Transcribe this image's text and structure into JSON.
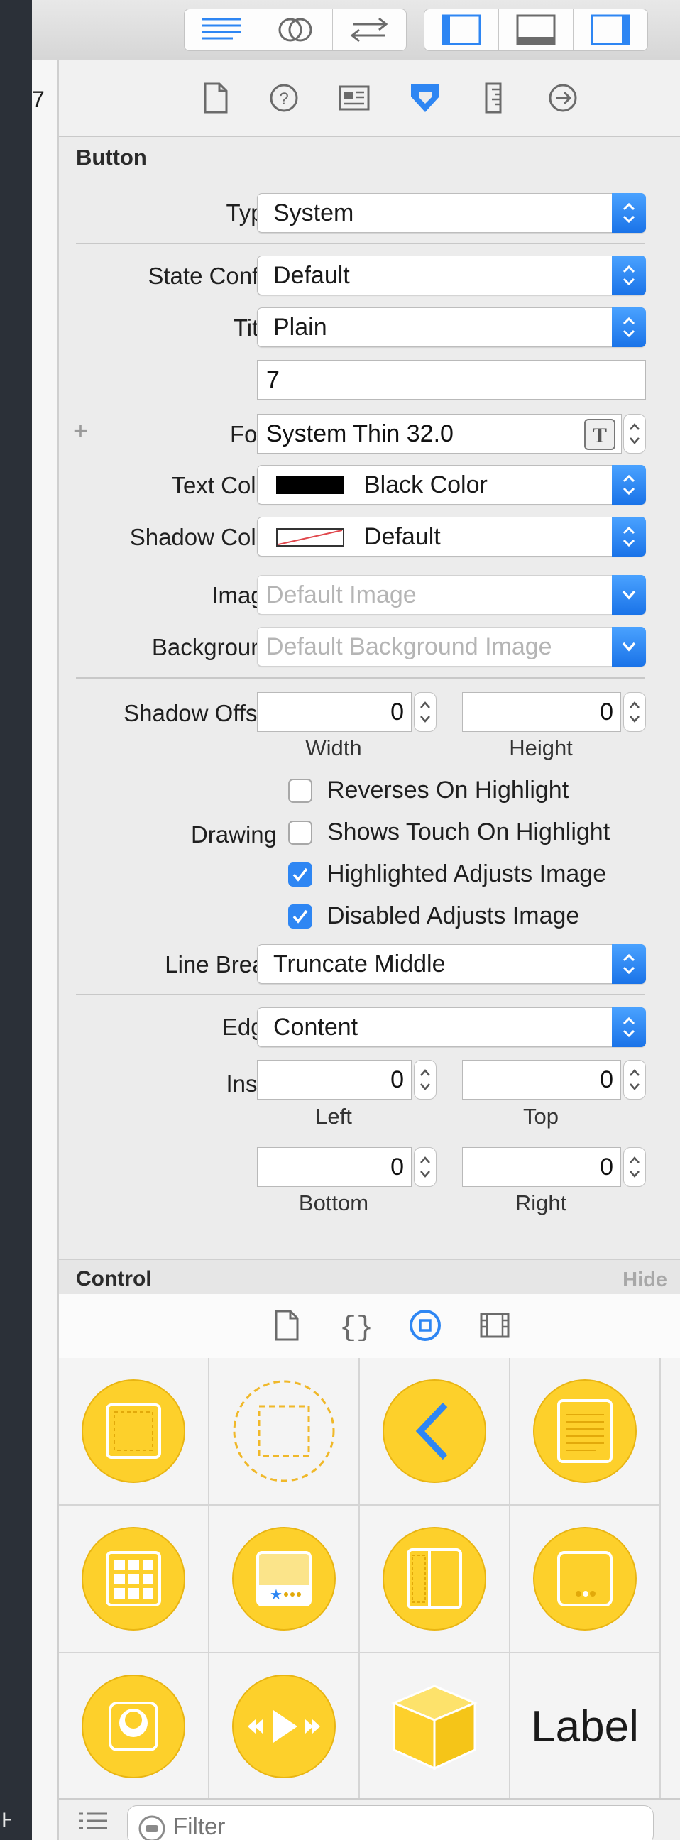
{
  "left_gutter": {
    "number": "7",
    "bottom_glyph": "H"
  },
  "inspector_tabs": [
    "file-inspector",
    "quick-help",
    "identity-inspector",
    "attributes-inspector",
    "size-inspector",
    "connections-inspector"
  ],
  "button_section": {
    "title": "Button",
    "type": {
      "label": "Type",
      "value": "System"
    },
    "state_config": {
      "label": "State Config",
      "value": "Default"
    },
    "title_field": {
      "label": "Title",
      "value": "Plain"
    },
    "title_text": "7",
    "font": {
      "label": "Font",
      "value": "System Thin 32.0",
      "add_symbol": "+"
    },
    "text_color": {
      "label": "Text Color",
      "value": "Black Color",
      "swatch": "#000000"
    },
    "shadow_color": {
      "label": "Shadow Color",
      "value": "Default"
    },
    "image": {
      "label": "Image",
      "placeholder": "Default Image"
    },
    "background": {
      "label": "Background",
      "placeholder": "Default Background Image"
    },
    "shadow_offset": {
      "label": "Shadow Offset",
      "width": "0",
      "height": "0",
      "width_label": "Width",
      "height_label": "Height"
    },
    "drawing": {
      "label": "Drawing",
      "options": [
        {
          "label": "Reverses On Highlight",
          "checked": false
        },
        {
          "label": "Shows Touch On Highlight",
          "checked": false
        },
        {
          "label": "Highlighted Adjusts Image",
          "checked": true
        },
        {
          "label": "Disabled Adjusts Image",
          "checked": true
        }
      ]
    },
    "line_break": {
      "label": "Line Break",
      "value": "Truncate Middle"
    },
    "edge": {
      "label": "Edge",
      "value": "Content"
    },
    "inset": {
      "label": "Inset",
      "left": "0",
      "top": "0",
      "bottom": "0",
      "right": "0",
      "left_label": "Left",
      "top_label": "Top",
      "bottom_label": "Bottom",
      "right_label": "Right"
    }
  },
  "control_section": {
    "title": "Control",
    "hide_label": "Hide"
  },
  "library_tabs": [
    "file-template-library",
    "code-snippet-library",
    "object-library",
    "media-library"
  ],
  "library_items": [
    "view",
    "container-view",
    "back-chevron",
    "text-view",
    "collection-view",
    "tab-bar",
    "split-view",
    "page-control",
    "image-view",
    "media-controls",
    "scenekit-cube",
    "label"
  ],
  "library_label_text": "Label",
  "filter": {
    "placeholder": "Filter"
  },
  "colors": {
    "accent": "#2e86f3",
    "library_yellow": "#fdd02b",
    "library_yellow_stroke": "#e9b512"
  }
}
